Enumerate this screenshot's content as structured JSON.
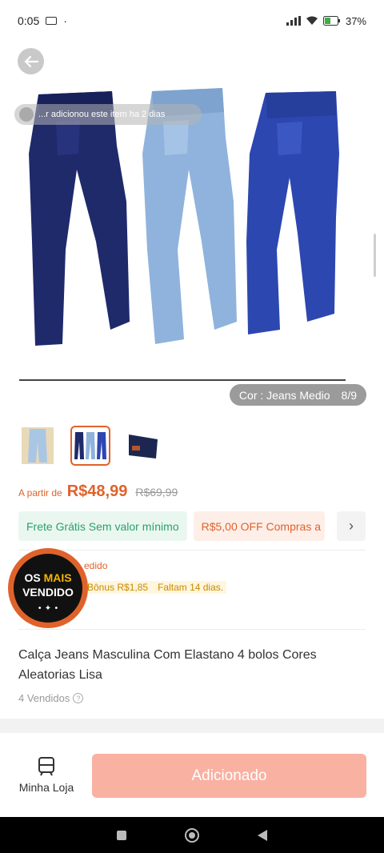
{
  "status_bar": {
    "time": "0:05",
    "battery": "37%"
  },
  "hero": {
    "toast_text": "...r adicionou este item ha 2 dias",
    "variant_label": "Cor : Jeans Medio",
    "image_counter": "8/9"
  },
  "thumbnails": [
    "jeans-light-wash",
    "jeans-three-colors",
    "jeans-folded-dark"
  ],
  "price": {
    "prefix": "A partir de",
    "current": "R$48,99",
    "original": "R$69,99"
  },
  "coupons": {
    "shipping": "Frete Grátis Sem valor mínimo",
    "discount": "R$5,00 OFF Compras a"
  },
  "bonus": {
    "title": "edido",
    "amount": "Bônus R$1,85",
    "deadline": "Faltam 14 dias."
  },
  "badge": {
    "line1": "OS",
    "line1_highlight": "MAIS",
    "line2": "VENDIDO"
  },
  "product": {
    "title": "Calça Jeans Masculina Com Elastano 4 bolos Cores Aleatorias Lisa",
    "sold": "4 Vendidos"
  },
  "bottom_bar": {
    "store_label": "Minha Loja",
    "add_label": "Adicionado"
  },
  "colors": {
    "accent": "#e0622b",
    "add_button": "#f9b1a2",
    "shipping_green": "#2aa06a"
  }
}
